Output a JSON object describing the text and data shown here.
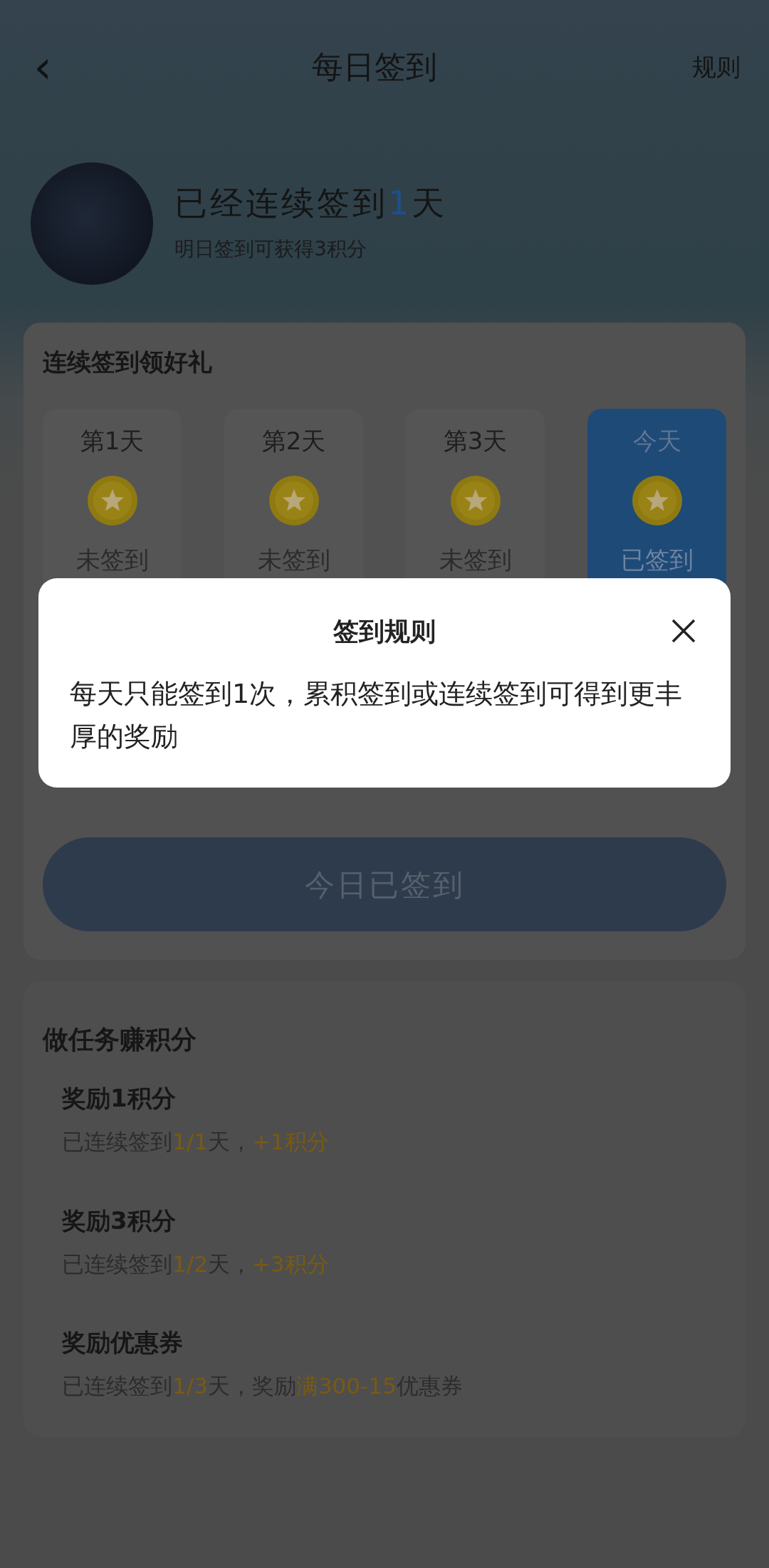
{
  "header": {
    "back": "‹",
    "title": "每日签到",
    "rules_link": "规则"
  },
  "profile": {
    "streak_parts": [
      {
        "text": "已经连续签到",
        "highlight": false
      },
      {
        "text": "1",
        "highlight": true
      },
      {
        "text": "天",
        "highlight": false
      }
    ],
    "subtitle": "明日签到可获得3积分"
  },
  "checkin_card": {
    "title": "连续签到领好礼",
    "days": [
      {
        "label": "第1天",
        "status": "未签到",
        "selected": false
      },
      {
        "label": "第2天",
        "status": "未签到",
        "selected": false
      },
      {
        "label": "第3天",
        "status": "未签到",
        "selected": false
      },
      {
        "label": "今天",
        "status": "已签到",
        "selected": true
      }
    ],
    "button": {
      "label": "今日已签到",
      "disabled": true
    }
  },
  "tasks": {
    "title": "做任务赚积分",
    "items": [
      {
        "title": "奖励1积分",
        "detail_parts": [
          {
            "text": "已连续签到",
            "highlight": false
          },
          {
            "text": "1/1",
            "highlight": true
          },
          {
            "text": "天，",
            "highlight": false
          },
          {
            "text": "+1积分",
            "highlight": true
          }
        ]
      },
      {
        "title": "奖励3积分",
        "detail_parts": [
          {
            "text": "已连续签到",
            "highlight": false
          },
          {
            "text": "1/2",
            "highlight": true
          },
          {
            "text": "天，",
            "highlight": false
          },
          {
            "text": "+3积分",
            "highlight": true
          }
        ]
      },
      {
        "title": "奖励优惠券",
        "detail_parts": [
          {
            "text": "已连续签到",
            "highlight": false
          },
          {
            "text": "1/3",
            "highlight": true
          },
          {
            "text": "天，奖励",
            "highlight": false
          },
          {
            "text": "满300-15",
            "highlight": true
          },
          {
            "text": "优惠券",
            "highlight": false
          }
        ]
      }
    ]
  },
  "dialog": {
    "title": "签到规则",
    "body": "每天只能签到1次，累积签到或连续签到可得到更丰厚的奖励"
  }
}
